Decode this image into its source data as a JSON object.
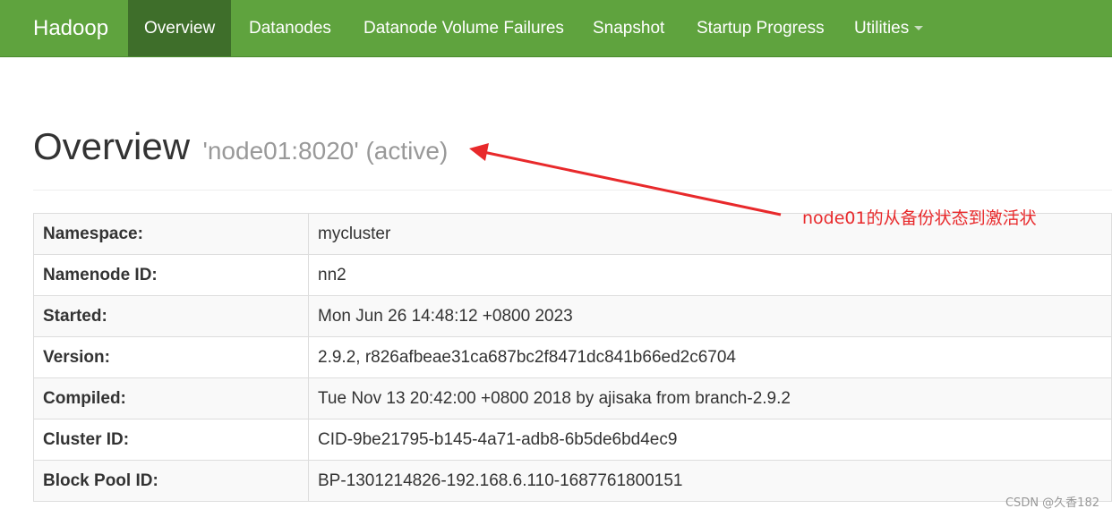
{
  "navbar": {
    "brand": "Hadoop",
    "items": [
      {
        "label": "Overview",
        "active": true
      },
      {
        "label": "Datanodes"
      },
      {
        "label": "Datanode Volume Failures"
      },
      {
        "label": "Snapshot"
      },
      {
        "label": "Startup Progress"
      },
      {
        "label": "Utilities"
      }
    ],
    "accent_color": "#5fa33e",
    "active_color": "#3e6e2a"
  },
  "header": {
    "title": "Overview",
    "subtitle": "'node01:8020' (active)"
  },
  "annotation": {
    "text": "node01的从备份状态到激活状",
    "color": "#e8292b"
  },
  "overview_table": {
    "rows": [
      {
        "label": "Namespace:",
        "value": "mycluster"
      },
      {
        "label": "Namenode ID:",
        "value": "nn2"
      },
      {
        "label": "Started:",
        "value": "Mon Jun 26 14:48:12 +0800 2023"
      },
      {
        "label": "Version:",
        "value": "2.9.2, r826afbeae31ca687bc2f8471dc841b66ed2c6704"
      },
      {
        "label": "Compiled:",
        "value": "Tue Nov 13 20:42:00 +0800 2018 by ajisaka from branch-2.9.2"
      },
      {
        "label": "Cluster ID:",
        "value": "CID-9be21795-b145-4a71-adb8-6b5de6bd4ec9"
      },
      {
        "label": "Block Pool ID:",
        "value": "BP-1301214826-192.168.6.110-1687761800151"
      }
    ]
  },
  "watermark": "CSDN @久香182"
}
